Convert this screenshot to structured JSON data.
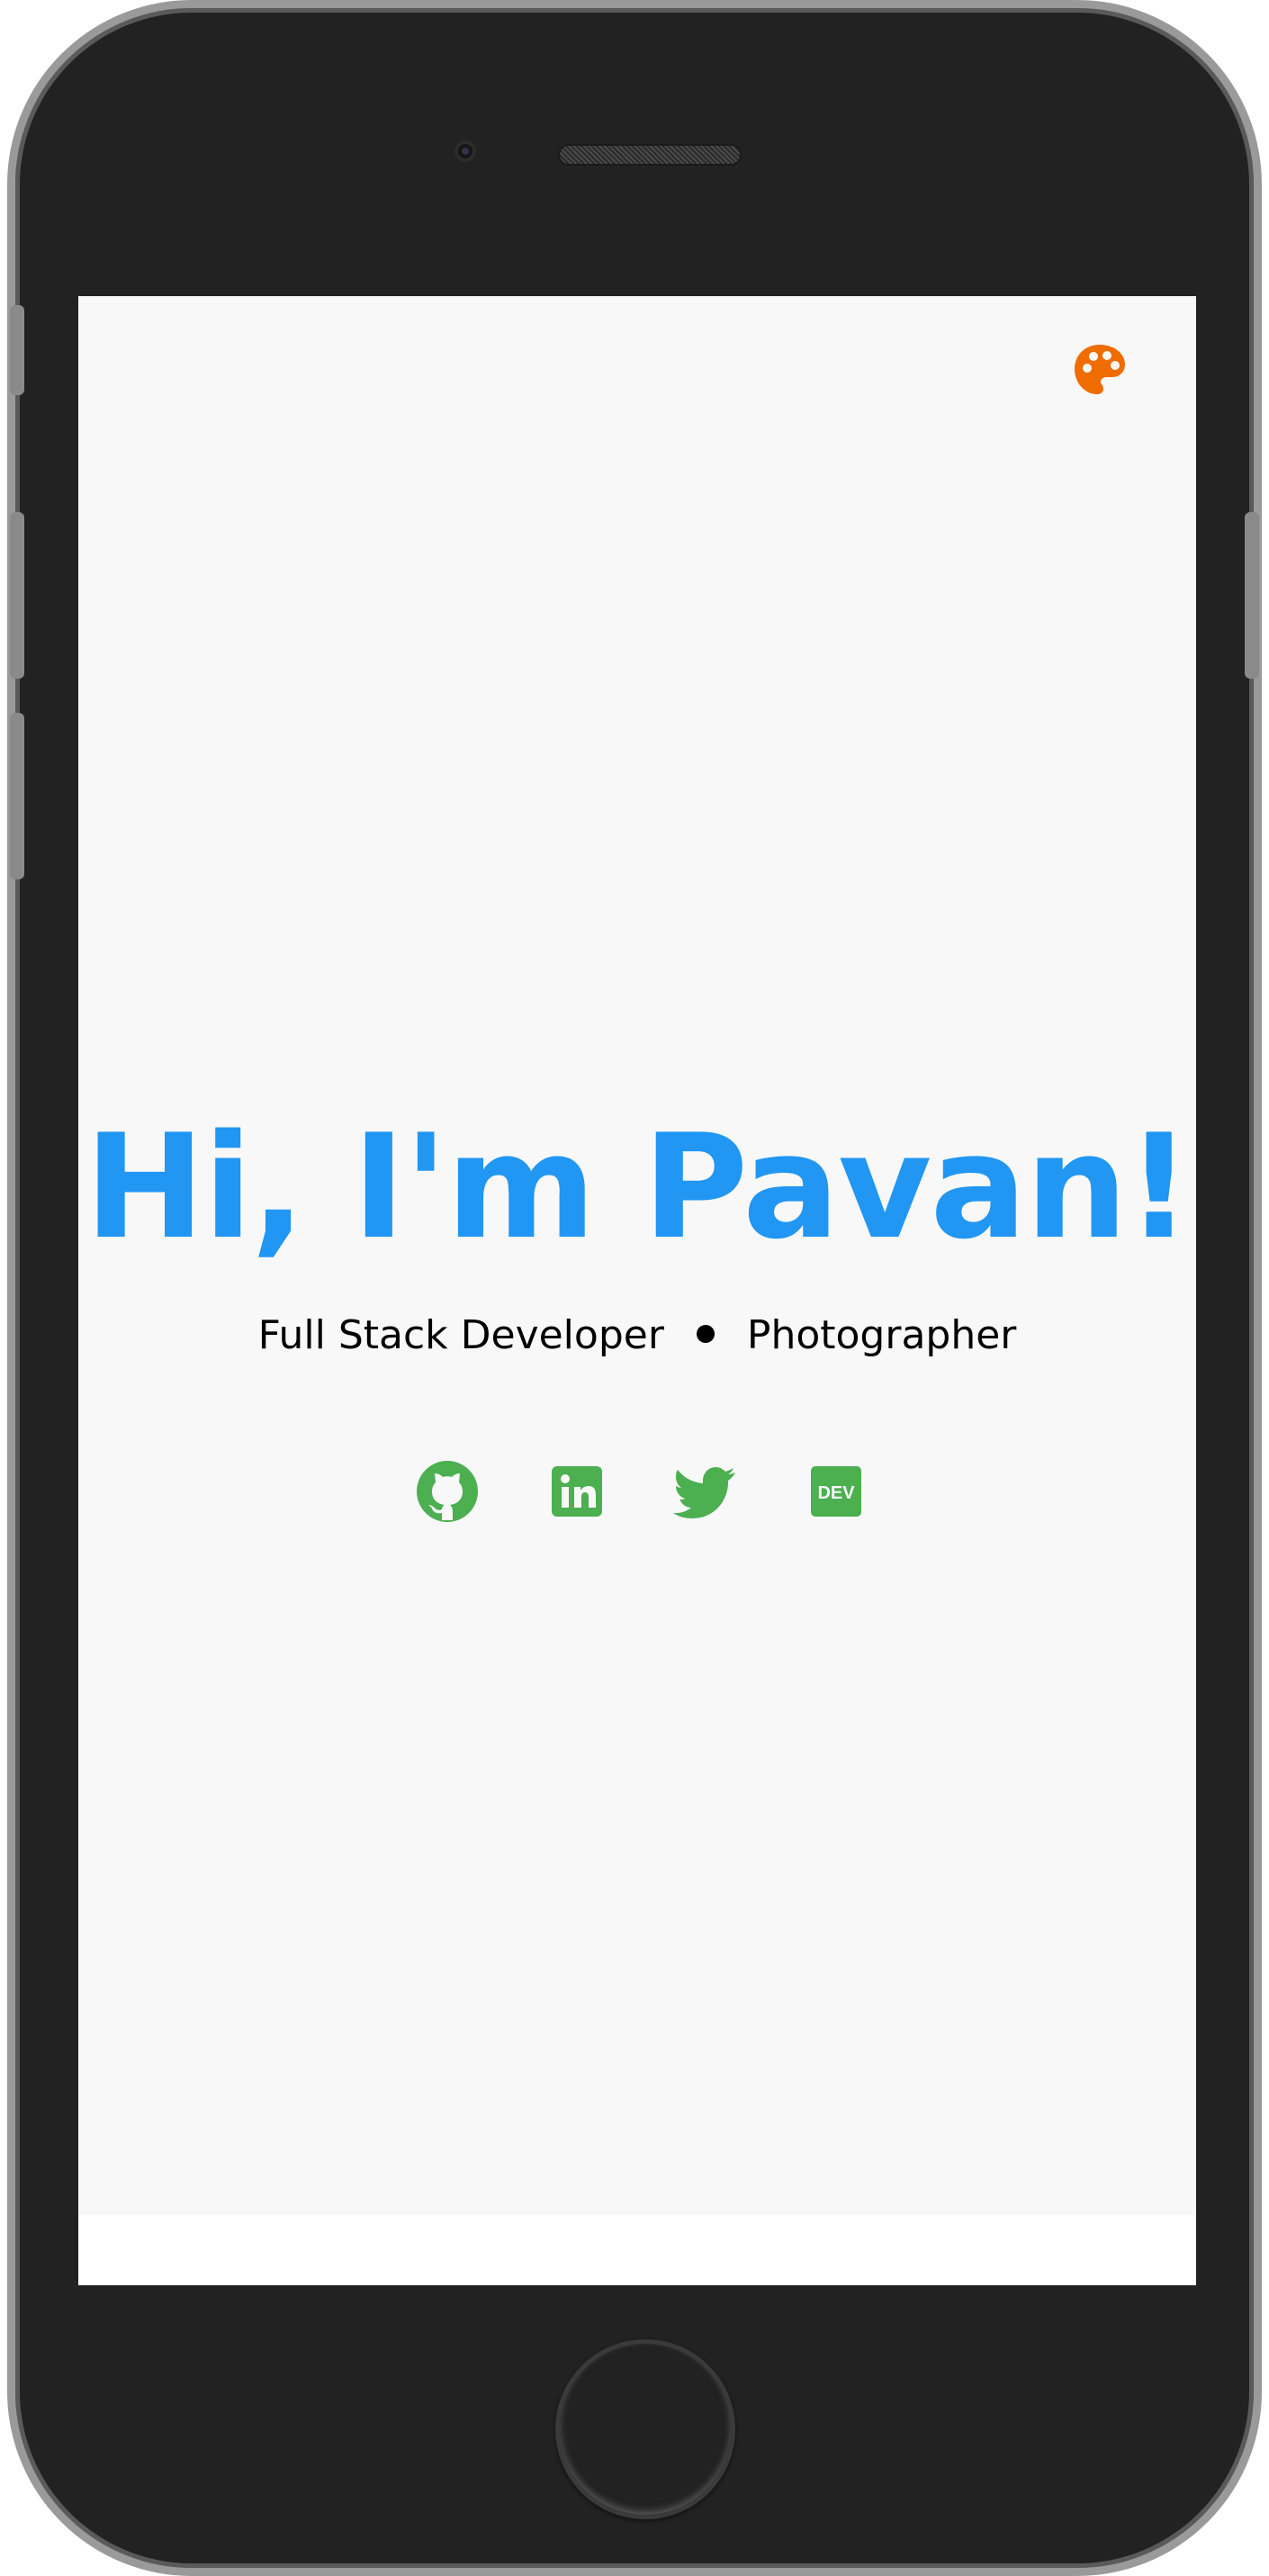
{
  "theme_toggle": {
    "icon": "palette-icon",
    "color": "#ef6c00"
  },
  "hero": {
    "headline": "Hi, I'm Pavan!",
    "headline_color": "#2196f3",
    "roles": [
      "Full Stack Developer",
      "Photographer"
    ]
  },
  "socials": [
    {
      "name": "GitHub",
      "icon": "github-icon"
    },
    {
      "name": "LinkedIn",
      "icon": "linkedin-icon"
    },
    {
      "name": "Twitter",
      "icon": "twitter-icon"
    },
    {
      "name": "DEV",
      "icon": "dev-icon",
      "label": "DEV"
    }
  ],
  "social_color": "#4caf50",
  "background": "#f8f8f8"
}
